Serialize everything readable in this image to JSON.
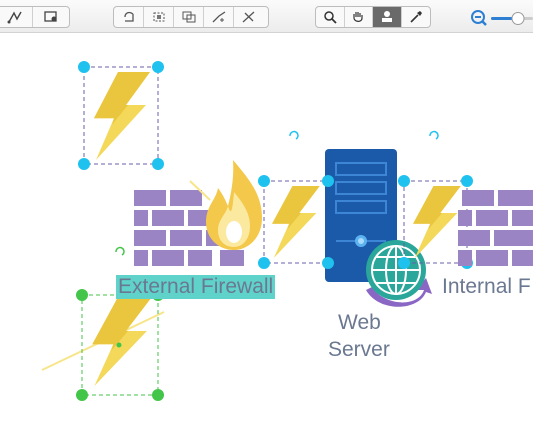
{
  "toolbar": {
    "groups": [
      {
        "name": "draw-tools",
        "items": [
          "connector-tool-icon",
          "insert-container-icon"
        ]
      },
      {
        "name": "connector-tools",
        "items": [
          "rotate-icon",
          "crop-icon",
          "group-icon",
          "bezier-icon",
          "smart-connect-icon"
        ]
      },
      {
        "name": "view-tools",
        "items": [
          "zoom-search-icon",
          "hand-pan-icon",
          "format-painter-icon",
          "eyedropper-icon"
        ]
      }
    ],
    "active_tool": "format-painter-icon",
    "zoom_slider": {
      "level": 0.3
    }
  },
  "diagram": {
    "labels": {
      "external_firewall": "External Firewall",
      "internal_firewall": "Internal F",
      "web_server_line1": "Web",
      "web_server_line2": "Server"
    }
  },
  "colors": {
    "brick": "#9b84c4",
    "bolt": "#f3d85a",
    "server": "#1a5aa8",
    "handle_blue": "#1fc2ee",
    "handle_green": "#43c54a",
    "label_highlight": "#5fd3c9",
    "label_text": "#6b7891"
  }
}
